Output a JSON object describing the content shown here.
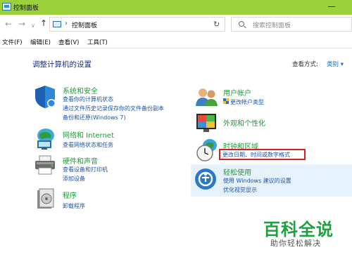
{
  "window": {
    "title": "控制面板",
    "title_bar_color": "#9bd23c"
  },
  "address_bar": {
    "back_icon": "back-arrow-icon",
    "forward_icon": "forward-arrow-icon",
    "up_icon": "up-arrow-icon",
    "breadcrumb": "控制面板",
    "refresh_icon": "refresh-icon",
    "search_placeholder": "搜索控制面板"
  },
  "menu": {
    "items": [
      "文件(F)",
      "编辑(E)",
      "查看(V)",
      "工具(T)"
    ]
  },
  "main": {
    "heading": "调整计算机的设置",
    "view_by_label": "查看方式:",
    "view_by_value": "类别 ▾",
    "categories_left": [
      {
        "title": "系统和安全",
        "icon": "shield-icon",
        "links": [
          "查看你的计算机状态",
          "通过文件历史记录保存你的文件备份副本",
          "备份和还原(Windows 7)"
        ]
      },
      {
        "title": "网络和 Internet",
        "icon": "network-icon",
        "links": [
          "查看网络状态和任务"
        ]
      },
      {
        "title": "硬件和声音",
        "icon": "printer-icon",
        "links": [
          "查看设备和打印机",
          "添加设备"
        ]
      },
      {
        "title": "程序",
        "icon": "programs-icon",
        "links": [
          "卸载程序"
        ]
      }
    ],
    "categories_right": [
      {
        "title": "用户帐户",
        "icon": "users-icon",
        "links": [
          "更改帐户类型"
        ]
      },
      {
        "title": "外观和个性化",
        "icon": "appearance-icon",
        "links": []
      },
      {
        "title": "时钟和区域",
        "icon": "clock-icon",
        "links": [
          "更改日期、时间或数字格式"
        ]
      },
      {
        "title": "轻松使用",
        "icon": "ease-of-access-icon",
        "links": [
          "使用 Windows 建议的设置",
          "优化视觉显示"
        ]
      }
    ],
    "highlight_color": "#d81e1e",
    "title_color": "#1f9a3a",
    "link_color": "#1c55a8"
  },
  "watermark": {
    "title": "百科全说",
    "subtitle": "助你轻松解决"
  }
}
